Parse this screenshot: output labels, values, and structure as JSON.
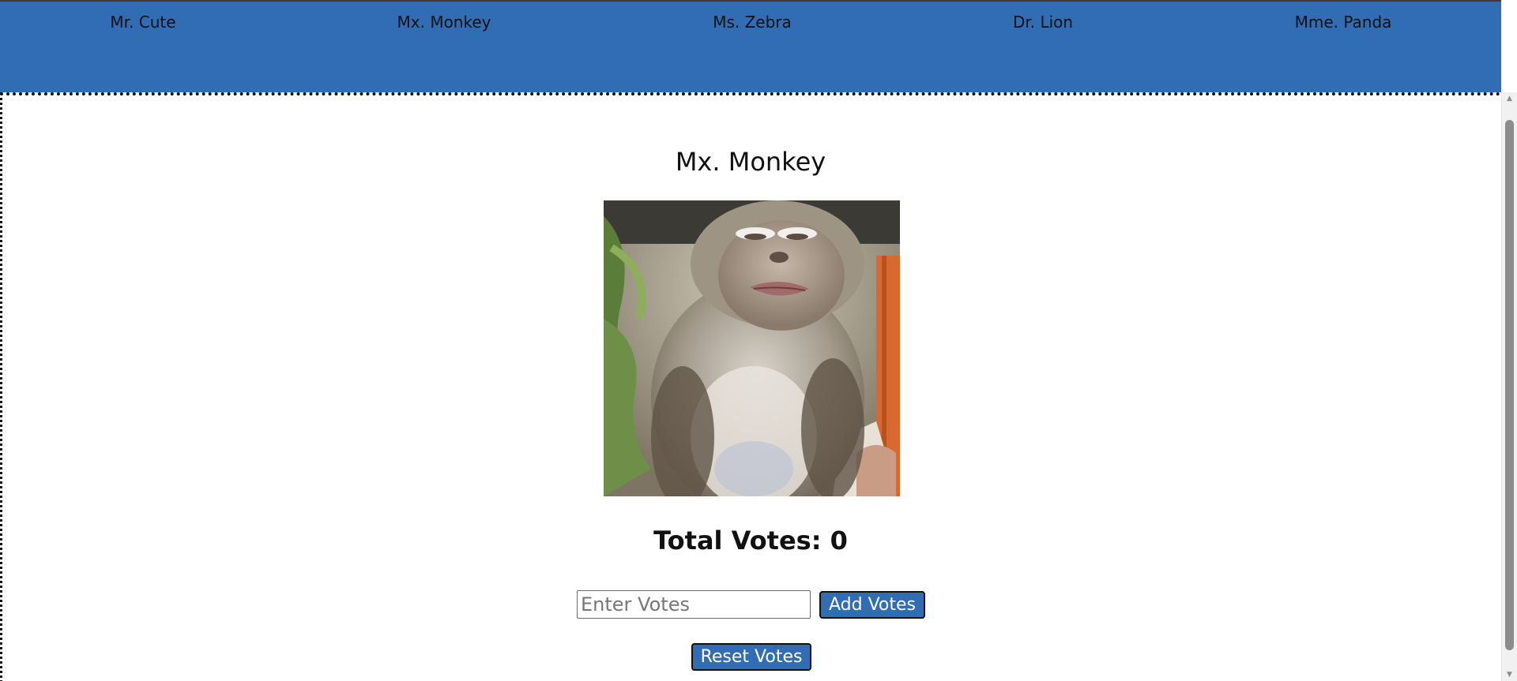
{
  "nav": {
    "items": [
      {
        "label": "Mr. Cute"
      },
      {
        "label": "Mx. Monkey"
      },
      {
        "label": "Ms. Zebra"
      },
      {
        "label": "Dr. Lion"
      },
      {
        "label": "Mme. Panda"
      }
    ]
  },
  "main": {
    "animal_name": "Mx. Monkey",
    "total_votes_label": "Total Votes: 0",
    "votes_input": {
      "value": "",
      "placeholder": "Enter Votes"
    },
    "add_button_label": "Add Votes",
    "reset_button_label": "Reset Votes"
  },
  "colors": {
    "header_bg": "#316db4",
    "button_bg": "#316db4",
    "page_bg": "#ffffff"
  },
  "icons": {
    "scroll_up": "scroll-up-arrow-icon",
    "scroll_down": "scroll-down-arrow-icon"
  }
}
